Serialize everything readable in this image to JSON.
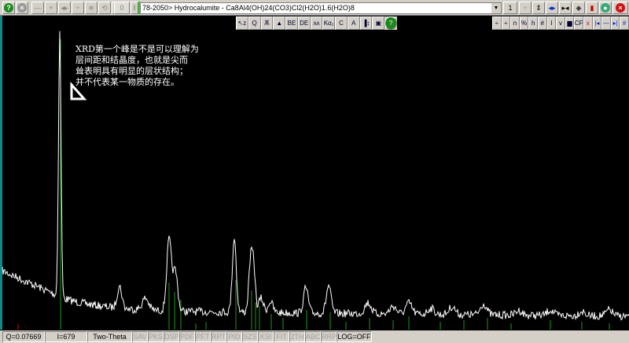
{
  "toolbar": {
    "counter_value": "0",
    "pattern_label": "78-2050> Hydrocalumite - Ca8Al4(OH)24(CO3)Cl2(H2O)1.6(H2O)8",
    "page_value": "1",
    "colors": {
      "help": "#1a8a1a",
      "close": "#d01010",
      "accent": "#0030d0"
    }
  },
  "plot_tools": [
    "↖z",
    "Q",
    "Ѫ",
    "▲",
    "BE",
    "DE",
    "ʌʌ",
    "Kα₂",
    "C",
    "A",
    "▐↕",
    "▣",
    "?"
  ],
  "right_tools": [
    "÷",
    "÷",
    "n",
    "%",
    "h",
    "#",
    "I",
    "v",
    "▆",
    "CF",
    "x",
    "|◂",
    "—",
    "▸|",
    "#"
  ],
  "annotation": "XRD第一个峰是不是可以理解为\n层间距和结晶度，也就是尖而\n耸表明具有明显的层状结构；\n并不代表某一物质的存在。",
  "status": {
    "q": "Q=0.07669",
    "i": "I=679",
    "axis": "Two-Theta",
    "buttons": [
      "SAV",
      "PKS",
      "DSP",
      "PDF",
      "PFT",
      "RPT",
      "PID",
      "SZS",
      "KSI",
      "FIT",
      "2TH",
      "ABC",
      "RRP"
    ],
    "log": "LOG=OFF"
  }
}
